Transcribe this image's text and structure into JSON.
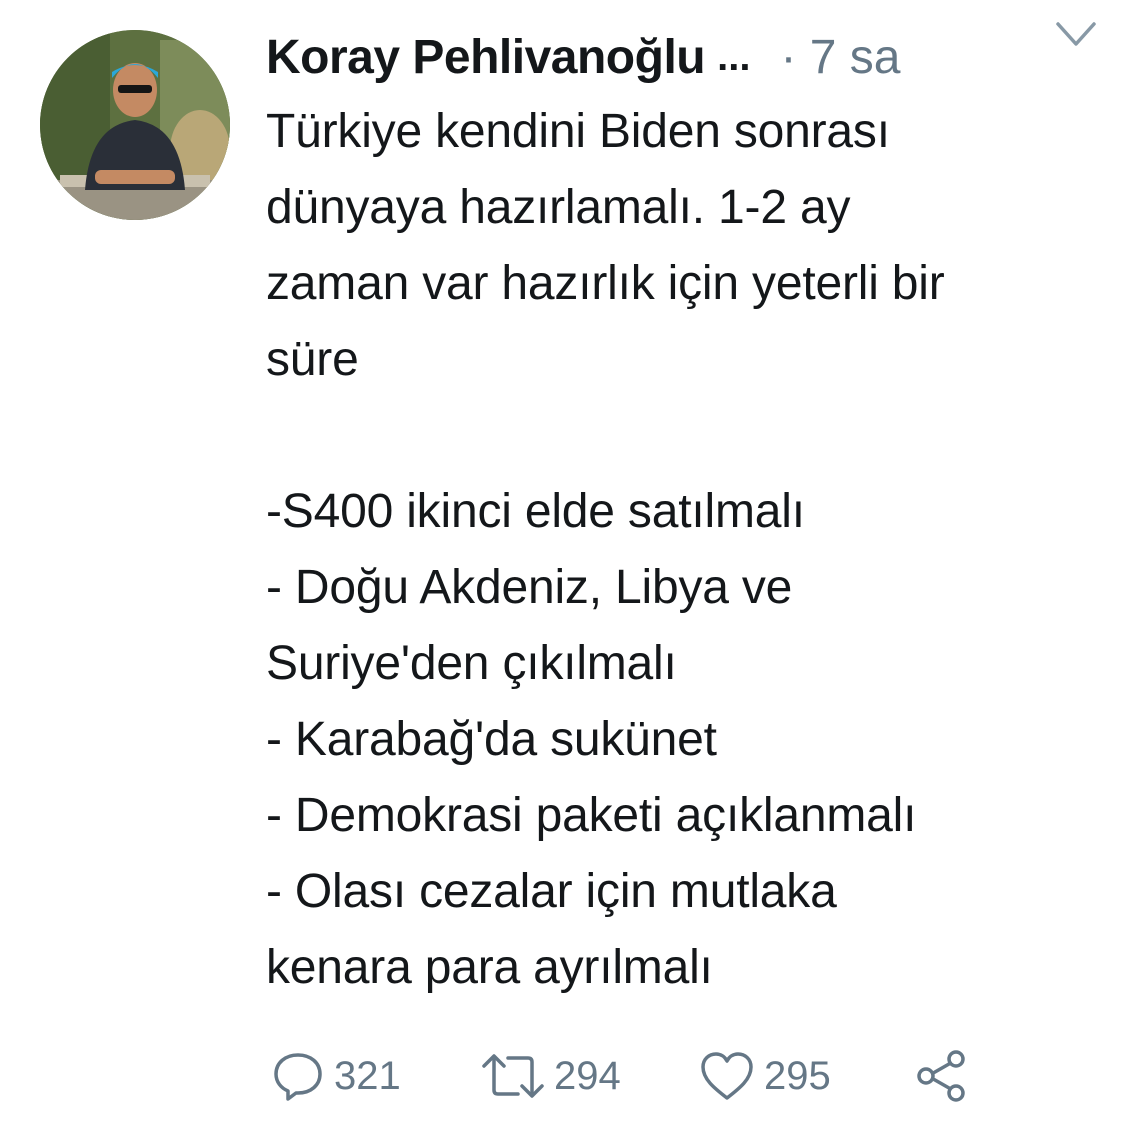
{
  "tweet": {
    "author_name": "Koray Pehlivanoğlu",
    "ellipsis": "...",
    "time": "· 7 sa",
    "text": "Türkiye kendini Biden sonrası\ndünyaya hazırlamalı. 1-2 ay\nzaman var hazırlık için yeterli bir\nsüre\n\n-S400 ikinci elde satılmalı\n- Doğu Akdeniz, Libya ve\nSuriye'den çıkılmalı\n- Karabağ'da sukünet\n- Demokrasi paketi açıklanmalı\n- Olası cezalar için mutlaka\nkenara para ayrılmalı",
    "actions": {
      "reply_count": "321",
      "retweet_count": "294",
      "like_count": "295"
    }
  },
  "icons": {
    "reply": "reply-icon",
    "retweet": "retweet-icon",
    "like": "heart-icon",
    "share": "share-icon",
    "menu": "chevron-down-icon"
  },
  "colors": {
    "text": "#14171a",
    "secondary": "#657786",
    "icon": "#657786",
    "background": "#ffffff"
  }
}
